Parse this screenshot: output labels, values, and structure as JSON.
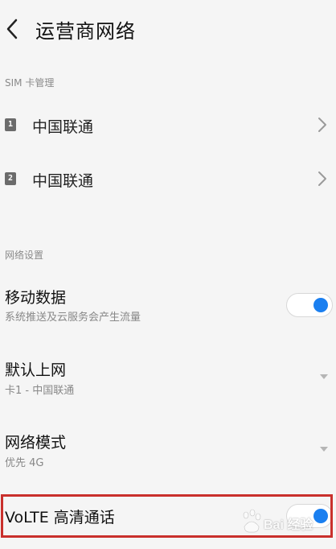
{
  "header": {
    "title": "运营商网络",
    "back_icon": "chevron-left-icon"
  },
  "sim_section": {
    "label": "SIM 卡管理",
    "cards": [
      {
        "slot": "1",
        "carrier": "中国联通"
      },
      {
        "slot": "2",
        "carrier": "中国联通"
      }
    ]
  },
  "network_section": {
    "label": "网络设置",
    "mobile_data": {
      "title": "移动数据",
      "subtitle": "系统推送及云服务会产生流量",
      "enabled": true
    },
    "default_internet": {
      "title": "默认上网",
      "subtitle": "卡1 - 中国联通"
    },
    "network_mode": {
      "title": "网络模式",
      "subtitle": "优先 4G"
    },
    "volte": {
      "title": "VoLTE 高清通话",
      "enabled": true
    }
  },
  "colors": {
    "accent": "#1a7ff0",
    "highlight": "#c9302c"
  },
  "watermark": {
    "text": "Bai 经验"
  }
}
